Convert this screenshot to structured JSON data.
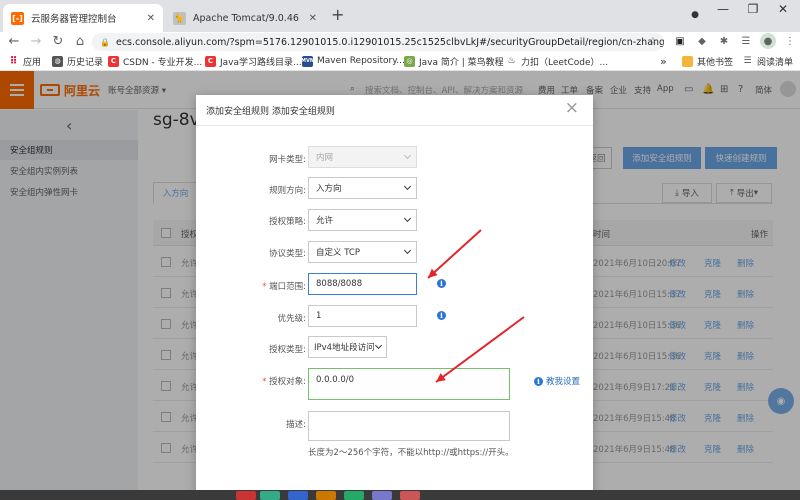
{
  "browser": {
    "tabs": [
      {
        "title": "云服务器管理控制台",
        "active": true
      },
      {
        "title": "Apache Tomcat/9.0.46",
        "active": false
      }
    ],
    "url": "ecs.console.aliyun.com/?spm=5176.12901015.0.i12901015.25c1525clbvLkJ#/securityGroupDetail/region/cn-zhangji...",
    "bookmarks": [
      "应用",
      "历史记录",
      "CSDN - 专业开发...",
      "Java学习路线目录...",
      "Maven Repository...",
      "Java 简介 | 菜鸟教程",
      "力扣（LeetCode）..."
    ],
    "bookmarks_overflow": "»",
    "bookmarks_right": [
      "其他书签",
      "阅读清单"
    ]
  },
  "aliyun": {
    "logo_text": "阿里云",
    "account_menu": "账号全部资源 ▾",
    "search_placeholder": "搜索文档、控制台、API、解决方案和资源",
    "header_links": [
      "费用",
      "工单",
      "备案",
      "企业",
      "支持",
      "App"
    ],
    "language": "简体"
  },
  "sidebar": {
    "collapse_icon": "‹",
    "items": [
      {
        "label": "安全组规则",
        "active": true
      },
      {
        "label": "安全组内实例列表",
        "active": false
      },
      {
        "label": "安全组内弹性网卡",
        "active": false
      }
    ]
  },
  "main": {
    "title": "sg-8vb",
    "back_button": "返回",
    "add_rule_button": "添加安全组规则",
    "quick_create_button": "快速创建规则",
    "tab_inbound": "入方向",
    "import_button": "导入",
    "export_button": "导出",
    "table_header": {
      "col_auth": "授权",
      "col_time": "时间",
      "col_action": "操作"
    },
    "rows": [
      {
        "policy": "允许",
        "time": "2021年6月10日20:07"
      },
      {
        "policy": "允许",
        "time": "2021年6月10日15:37"
      },
      {
        "policy": "允许",
        "time": "2021年6月10日15:36"
      },
      {
        "policy": "允许",
        "time": "2021年6月10日15:36"
      },
      {
        "policy": "允许",
        "time": "2021年6月9日17:21"
      },
      {
        "policy": "允许",
        "time": "2021年6月9日15:48"
      },
      {
        "policy": "允许",
        "time": "2021年6月9日15:48"
      }
    ],
    "row_actions": {
      "edit": "修改",
      "clone": "克隆",
      "delete": "删除"
    }
  },
  "dialog": {
    "title": "添加安全组规则",
    "title_secondary": "添加安全组规则",
    "fields": {
      "nic_type": {
        "label": "网卡类型:",
        "value": "内网"
      },
      "direction": {
        "label": "规则方向:",
        "value": "入方向"
      },
      "policy": {
        "label": "授权策略:",
        "value": "允许"
      },
      "protocol": {
        "label": "协议类型:",
        "value": "自定义 TCP"
      },
      "port_range": {
        "label": "端口范围:",
        "required_mark": "*",
        "value": "8088/8088"
      },
      "priority": {
        "label": "优先级:",
        "value": "1"
      },
      "auth_type": {
        "label": "授权类型:",
        "value": "IPv4地址段访问"
      },
      "auth_object": {
        "label": "授权对象:",
        "required_mark": "*",
        "value": "0.0.0.0/0"
      },
      "description": {
        "label": "描述:",
        "value": "",
        "help": "长度为2～256个字符，不能以http://或https://开头。"
      }
    },
    "tutorial_link": "教我设置",
    "close_icon": "×",
    "info_icon_glyph": "i"
  },
  "annotations": {
    "arrow_color": "#e0262a"
  },
  "colors": {
    "aliyun_orange": "#ff6a00",
    "primary_blue": "#6aa7e8",
    "focus_blue": "#3b7fd4",
    "success_green": "#74c26e"
  }
}
